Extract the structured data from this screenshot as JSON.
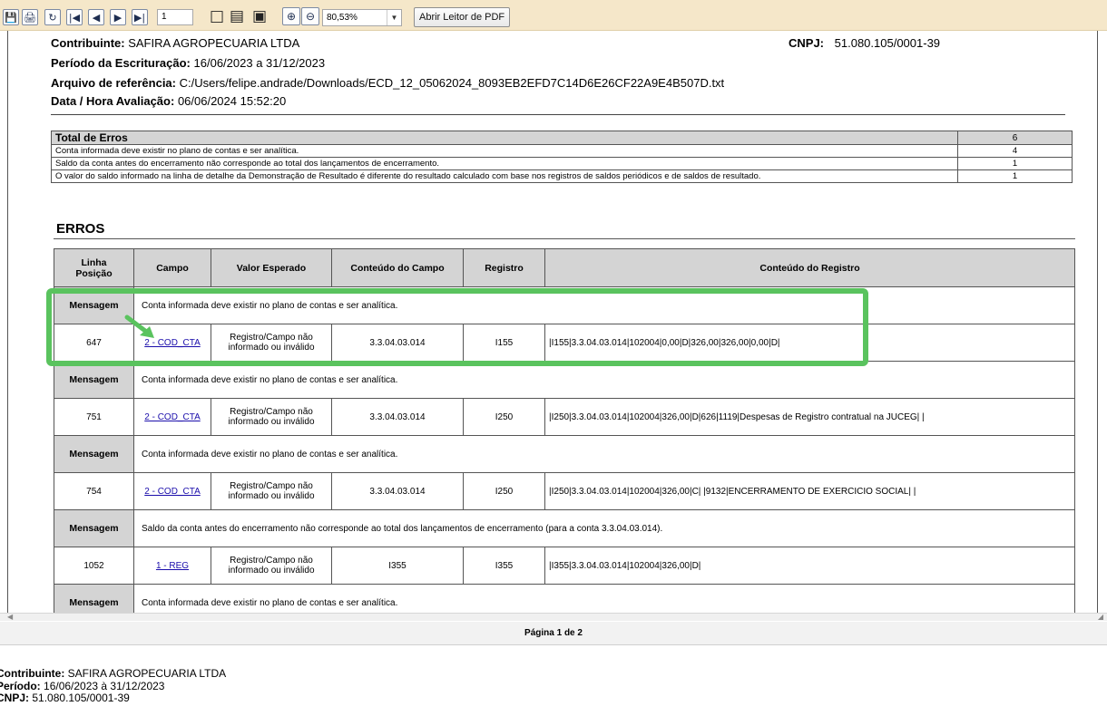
{
  "toolbar": {
    "page_value": "1",
    "zoom_value": "80,53%",
    "pdf_button_label": "Abrir Leitor de PDF"
  },
  "header": {
    "contribuinte_label": "Contribuinte:",
    "contribuinte_value": "SAFIRA AGROPECUARIA LTDA",
    "cnpj_label": "CNPJ:",
    "cnpj_value": "51.080.105/0001-39",
    "periodo_label": "Período da Escrituração:",
    "periodo_value": "16/06/2023 a 31/12/2023",
    "arquivo_label": "Arquivo de referência:",
    "arquivo_value": "C:/Users/felipe.andrade/Downloads/ECD_12_05062024_8093EB2EFD7C14D6E26CF22A9E4B507D.txt",
    "data_label": "Data / Hora Avaliação:",
    "data_value": "06/06/2024 15:52:20"
  },
  "totals": {
    "title": "Total de Erros",
    "total": "6",
    "rows": [
      {
        "desc": "Conta informada deve existir no plano de contas e ser analítica.",
        "count": "4"
      },
      {
        "desc": "Saldo da conta antes do encerramento não corresponde ao total dos lançamentos de encerramento.",
        "count": "1"
      },
      {
        "desc": "O valor do saldo informado na linha de detalhe da Demonstração de Resultado é diferente do resultado calculado com base nos registros de saldos periódicos e de saldos de resultado.",
        "count": "1"
      }
    ]
  },
  "errors": {
    "title": "ERROS",
    "columns": {
      "linha_line1": "Linha",
      "linha_line2": "Posição",
      "campo": "Campo",
      "valor": "Valor Esperado",
      "conteudo_campo": "Conteúdo do Campo",
      "registro": "Registro",
      "conteudo_registro": "Conteúdo do Registro"
    },
    "msg_label": "Mensagem",
    "entries": [
      {
        "message": "Conta informada deve existir no plano de contas e ser analítica.",
        "linha": "647",
        "campo": "2 - COD_CTA",
        "valor_l1": "Registro/Campo não",
        "valor_l2": "informado ou inválido",
        "conteudo_campo": "3.3.04.03.014",
        "registro": "I155",
        "conteudo_registro": "|I155|3.3.04.03.014|102004|0,00|D|326,00|326,00|0,00|D|"
      },
      {
        "message": "Conta informada deve existir no plano de contas e ser analítica.",
        "linha": "751",
        "campo": "2 - COD_CTA",
        "valor_l1": "Registro/Campo não",
        "valor_l2": "informado ou inválido",
        "conteudo_campo": "3.3.04.03.014",
        "registro": "I250",
        "conteudo_registro": "|I250|3.3.04.03.014|102004|326,00|D|626|1119|Despesas de Registro contratual na JUCEG| |"
      },
      {
        "message": "Conta informada deve existir no plano de contas e ser analítica.",
        "linha": "754",
        "campo": "2 - COD_CTA",
        "valor_l1": "Registro/Campo não",
        "valor_l2": "informado ou inválido",
        "conteudo_campo": "3.3.04.03.014",
        "registro": "I250",
        "conteudo_registro": "|I250|3.3.04.03.014|102004|326,00|C| |9132|ENCERRAMENTO DE EXERCICIO SOCIAL| |"
      },
      {
        "message": "Saldo da conta antes do encerramento não corresponde ao total dos lançamentos de encerramento (para a conta 3.3.04.03.014).",
        "linha": "1052",
        "campo": "1 - REG",
        "valor_l1": "Registro/Campo não",
        "valor_l2": "informado ou inválido",
        "conteudo_campo": "I355",
        "registro": "I355",
        "conteudo_registro": "|I355|3.3.04.03.014|102004|326,00|D|"
      }
    ],
    "last_message": "Conta informada deve existir no plano de contas e ser analítica."
  },
  "pager": {
    "text": "Página 1 de 2"
  },
  "footer": {
    "contribuinte_label": "Contribuinte:",
    "contribuinte_value": "SAFIRA AGROPECUARIA LTDA",
    "periodo_label": "Período:",
    "periodo_value": "16/06/2023 à 31/12/2023",
    "cnpj_label": "CNPJ:",
    "cnpj_value": "51.080.105/0001-39"
  },
  "colors": {
    "toolbar_bg": "#f5e7c9",
    "highlight": "#5ac35e",
    "header_cell_bg": "#d4d4d4",
    "link": "#1a0dab"
  }
}
